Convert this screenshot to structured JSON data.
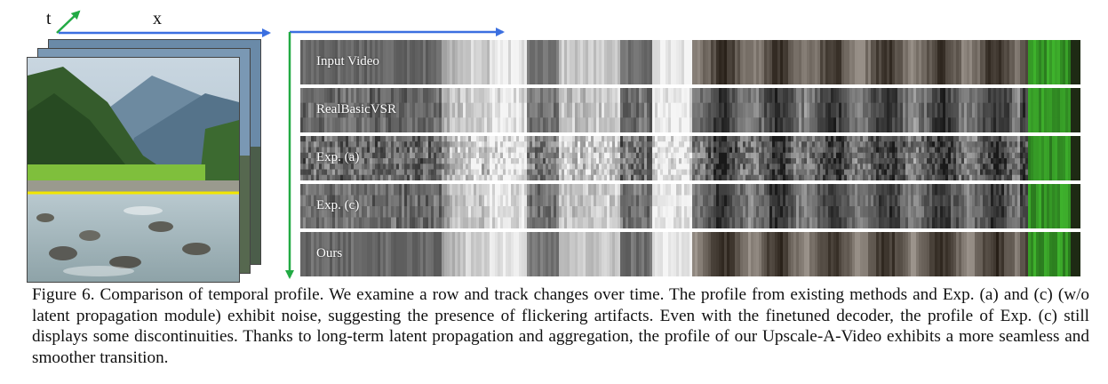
{
  "axes": {
    "t_label": "t",
    "x_label": "x"
  },
  "colors": {
    "x_arrow": "#3b6fe0",
    "t_arrow": "#22aa44",
    "row_line": "#f2e600"
  },
  "rows": [
    {
      "label": "Input Video",
      "quality": "smooth"
    },
    {
      "label": "RealBasicVSR",
      "quality": "blurry"
    },
    {
      "label": "Exp. (a)",
      "quality": "noisy"
    },
    {
      "label": "Exp. (c)",
      "quality": "discontinuous"
    },
    {
      "label": "Ours",
      "quality": "smooth"
    }
  ],
  "caption": {
    "text": "Figure 6. Comparison of temporal profile. We examine a row and track changes over time. The profile from existing methods and Exp. (a) and (c) (w/o latent propagation module) exhibit noise, suggesting the presence of flickering artifacts. Even with the finetuned decoder, the profile of Exp. (c) still displays some discontinuities. Thanks to long-term latent propagation and aggregation, the profile of our Upscale-A-Video exhibits a more seamless and smoother transition."
  }
}
